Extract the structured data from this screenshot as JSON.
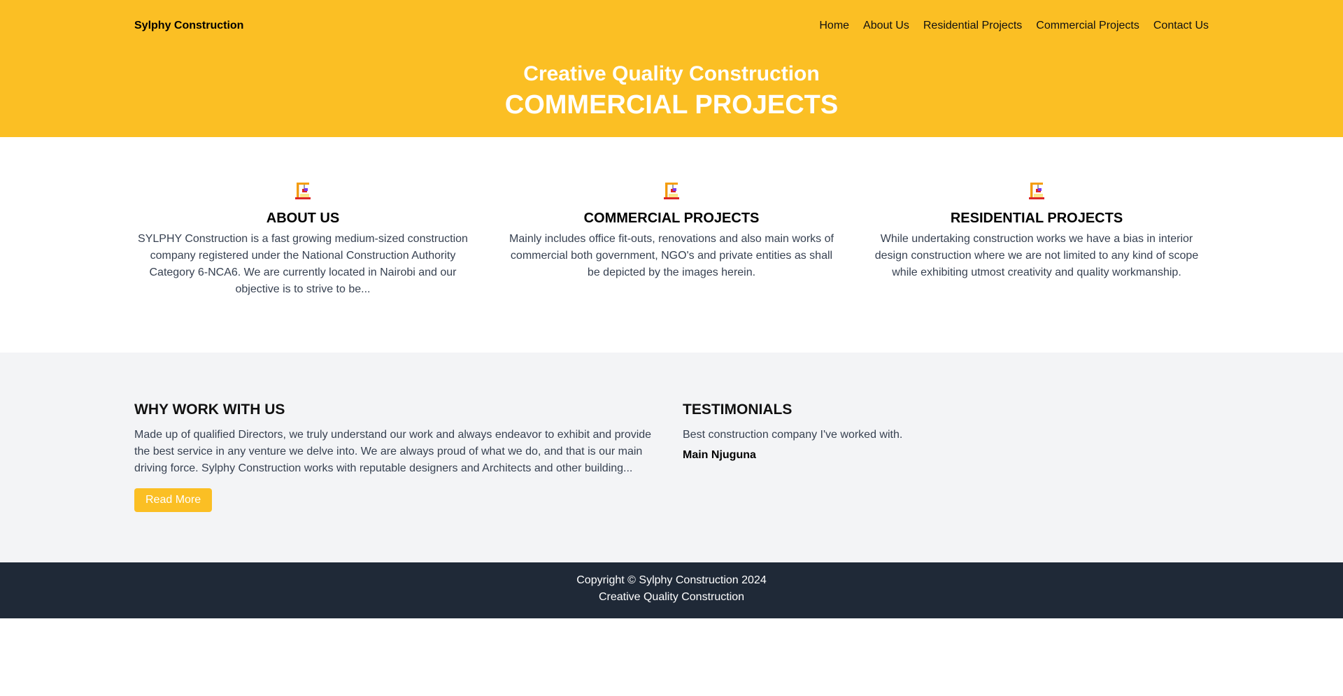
{
  "header": {
    "brand": "Sylphy Construction",
    "nav": [
      "Home",
      "About Us",
      "Residential Projects",
      "Commercial Projects",
      "Contact Us"
    ],
    "tagline": "Creative Quality Construction",
    "title": "COMMERCIAL PROJECTS"
  },
  "features": [
    {
      "icon": "crane-icon",
      "title": "ABOUT US",
      "text": "SYLPHY Construction is a fast growing medium-sized construction company registered under the National Construction Authority Category 6-NCA6. We are currently located in Nairobi and our objective is to strive to be..."
    },
    {
      "icon": "crane-icon",
      "title": "COMMERCIAL PROJECTS",
      "text": "Mainly includes office fit-outs, renovations and also main works of commercial both government, NGO's and private entities as shall be depicted by the images herein."
    },
    {
      "icon": "crane-icon",
      "title": "RESIDENTIAL PROJECTS",
      "text": "While undertaking construction works we have a bias in interior design construction where we are not limited to any kind of scope while exhibiting utmost creativity and quality workmanship."
    }
  ],
  "why": {
    "title": "WHY WORK WITH US",
    "text": "Made up of qualified Directors, we truly understand our work and always endeavor to exhibit and provide the best service in any venture we delve into. We are always proud of what we do, and that is our main driving force. Sylphy Construction works with reputable designers and Architects and other building...",
    "button": "Read More"
  },
  "testimonials": {
    "title": "TESTIMONIALS",
    "quote": "Best construction company I've worked with.",
    "author": "Main Njuguna"
  },
  "footer": {
    "copyright": "Copyright © Sylphy Construction 2024",
    "tagline": "Creative Quality Construction"
  },
  "colors": {
    "accent": "#fbbf24",
    "footer_bg": "#1f2937",
    "section_bg": "#f3f4f6"
  }
}
